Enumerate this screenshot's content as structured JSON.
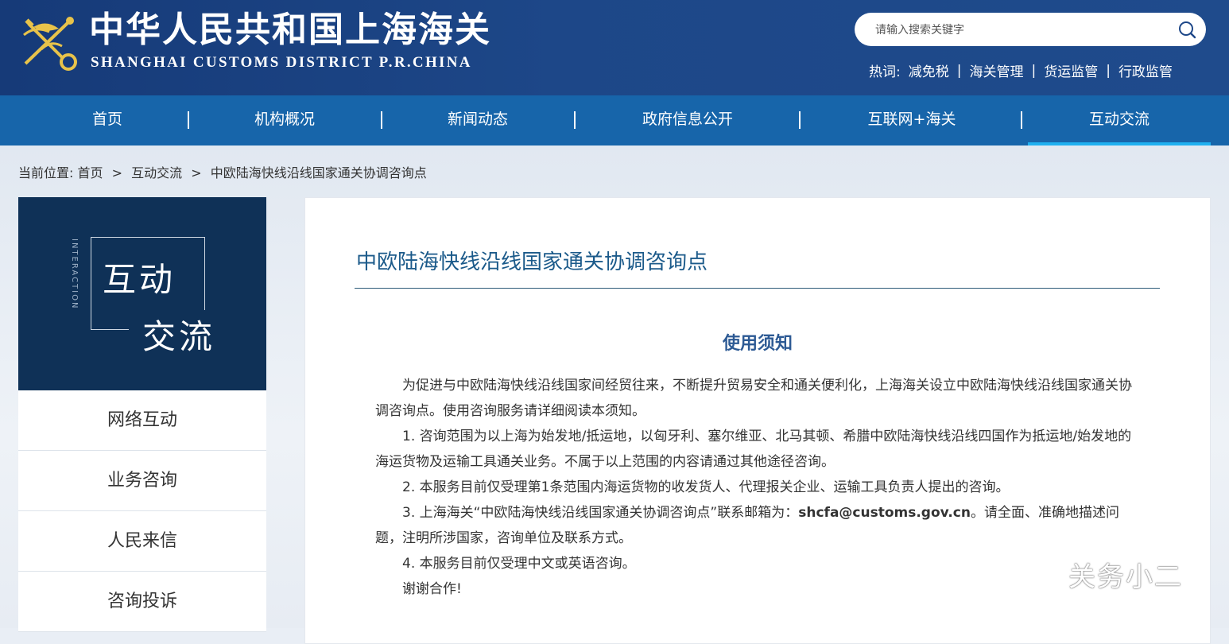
{
  "header": {
    "logo_cn": "中华人民共和国上海海关",
    "logo_en": "SHANGHAI CUSTOMS DISTRICT P.R.CHINA",
    "search": {
      "placeholder": "请输入搜索关键字"
    },
    "hotwords": {
      "label": "热词:",
      "items": [
        "减免税",
        "海关管理",
        "货运监管",
        "行政监管"
      ]
    }
  },
  "nav": {
    "items": [
      "首页",
      "机构概况",
      "新闻动态",
      "政府信息公开",
      "互联网+海关",
      "互动交流"
    ],
    "active": "互动交流"
  },
  "breadcrumb": {
    "label": "当前位置:",
    "items": [
      "首页",
      "互动交流",
      "中欧陆海快线沿线国家通关协调咨询点"
    ]
  },
  "sidebar": {
    "banner_en": "INTERACTION",
    "banner_line1": "互动",
    "banner_line2": "交流",
    "menu": [
      "网络互动",
      "业务咨询",
      "人民来信",
      "咨询投诉"
    ]
  },
  "main": {
    "title": "中欧陆海快线沿线国家通关协调咨询点",
    "notice_title": "使用须知",
    "paragraphs": {
      "p0": "为促进与中欧陆海快线沿线国家间经贸往来，不断提升贸易安全和通关便利化，上海海关设立中欧陆海快线沿线国家通关协调咨询点。使用咨询服务请详细阅读本须知。",
      "p1": "1. 咨询范围为以上海为始发地/抵运地，以匈牙利、塞尔维亚、北马其顿、希腊中欧陆海快线沿线四国作为抵运地/始发地的海运货物及运输工具通关业务。不属于以上范围的内容请通过其他途径咨询。",
      "p2": "2. 本服务目前仅受理第1条范围内海运货物的收发货人、代理报关企业、运输工具负责人提出的咨询。",
      "p3_pre": "3. 上海海关“中欧陆海快线沿线国家通关协调咨询点”联系邮箱为：",
      "p3_email": "shcfa@customs.gov.cn",
      "p3_post": "。请全面、准确地描述问题，注明所涉国家，咨询单位及联系方式。",
      "p4": "4. 本服务目前仅受理中文或英语咨询。",
      "p5": "谢谢合作!"
    }
  },
  "watermark": {
    "text": "关务小二"
  },
  "colors": {
    "header_bg": "#1d4788",
    "nav_bg": "#1765aa",
    "nav_active_bar": "#1fb0f0",
    "sidebar_banner": "#0f3157",
    "title": "#1b5a8a",
    "notice_title": "#2d5a94"
  }
}
